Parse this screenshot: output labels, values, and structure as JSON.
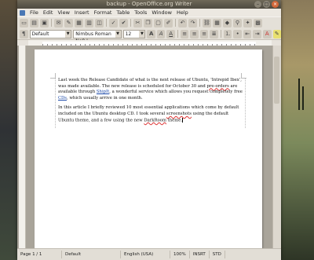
{
  "window": {
    "title": "backup - OpenOffice.org Writer"
  },
  "window_controls": {
    "minimize": "–",
    "maximize": "□",
    "close": "×"
  },
  "menu": [
    "File",
    "Edit",
    "View",
    "Insert",
    "Format",
    "Table",
    "Tools",
    "Window",
    "Help"
  ],
  "toolbar": {
    "icons": [
      "new",
      "open",
      "save",
      "email",
      "edit",
      "pdf",
      "print",
      "preview",
      "spellcheck",
      "autospell",
      "cut",
      "copy",
      "paste",
      "format-paintbrush",
      "undo",
      "redo",
      "hyperlink",
      "table",
      "show-draw",
      "find",
      "navigator",
      "gallery",
      "datasources",
      "nonprint-chars",
      "zoom",
      "help"
    ]
  },
  "formatting": {
    "style": "Default",
    "font": "Nimbus Roman No9 L",
    "size": "12",
    "buttons": [
      "bold",
      "italic",
      "underline",
      "align-left",
      "align-center",
      "align-right",
      "justify",
      "numbering",
      "bullets",
      "decrease-indent",
      "increase-indent",
      "font-color",
      "highlight",
      "background-color"
    ]
  },
  "document": {
    "p1_a": "Last week the Release Candidate of what is the next release of Ubuntu, 'Intrepid Ibex', was made available. The new release is scheduled for October 30 and ",
    "p1_prereg": "pre-orders",
    "p1_b": " are available through ",
    "p1_shipit": "ShipIt",
    "p1_c": ", a wonderful service which allows you request completely free ",
    "p1_cds": "CDs",
    "p1_d": ", which usually arrive in one month.",
    "p2_a": "In this article I briefly reviewed 10 most essential applications which come by default included on the Ubuntu desktop CD. I took several ",
    "p2_screens": "screenshots",
    "p2_b": " using the default Ubuntu theme, and a few using the new ",
    "p2_dark": "DarkRoom",
    "p2_c": " theme."
  },
  "status": {
    "page": "Page 1 / 1",
    "style": "Default",
    "language": "English (USA)",
    "zoom": "100%",
    "mode": "INSRT",
    "selection": "STD"
  }
}
